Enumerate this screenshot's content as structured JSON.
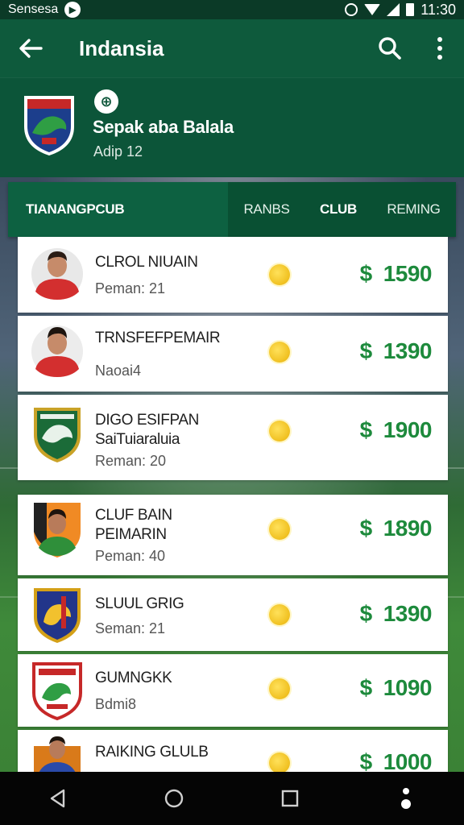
{
  "status_bar": {
    "carrier": "Sensesa",
    "time": "11:30"
  },
  "app_bar": {
    "title": "Indansia"
  },
  "league": {
    "name": "Sepak aba Balala",
    "subtitle": "Adip 12"
  },
  "tabs": [
    {
      "label": "TIANANGPCUB"
    },
    {
      "label": "RANBS"
    },
    {
      "label": "CLUB"
    },
    {
      "label": "REMING"
    }
  ],
  "items": [
    {
      "name": "CLROL NIUAIN",
      "sub": "Peman: 21",
      "currency": "$",
      "price": "1590",
      "avatar": "player-red"
    },
    {
      "name": "TRNSFEFPEMAIR",
      "sub": "Naoai4",
      "currency": "$",
      "price": "1390",
      "avatar": "player-red"
    },
    {
      "name": "DIGO ESIFPAN\nSaiTuiaraluia",
      "sub": "Reman: 20",
      "currency": "$",
      "price": "1900",
      "avatar": "crest-green"
    },
    {
      "name": "CLUF BAIN\nPEIMARIN",
      "sub": "Peman: 40",
      "currency": "$",
      "price": "1890",
      "avatar": "player-crest"
    },
    {
      "name": "SLUUL GRIG",
      "sub": "Seman: 21",
      "currency": "$",
      "price": "1390",
      "avatar": "crest-blue"
    },
    {
      "name": "GUMNGKK",
      "sub": "Bdmi8",
      "currency": "$",
      "price": "1090",
      "avatar": "crest-red"
    },
    {
      "name": "RAIKING GLULB",
      "sub": "",
      "currency": "$",
      "price": "1000",
      "avatar": "player-blue"
    }
  ],
  "colors": {
    "primary": "#0e5a3c",
    "price": "#1d8a3c",
    "coin": "#f0c020"
  }
}
